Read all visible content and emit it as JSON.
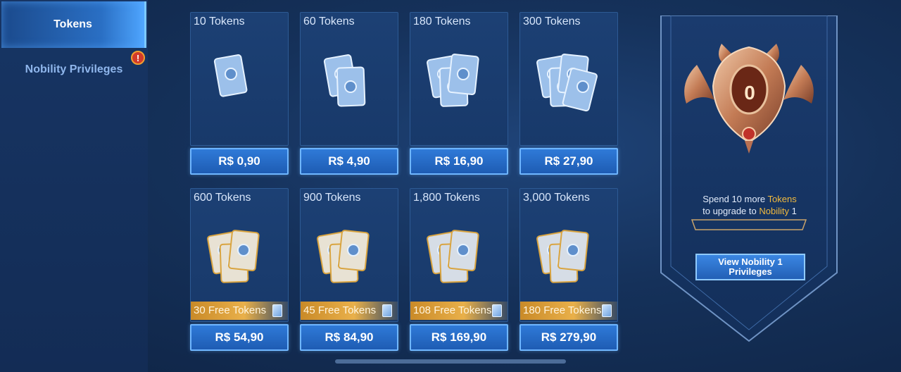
{
  "sidebar": {
    "tabs": [
      {
        "label": "Tokens",
        "active": true
      },
      {
        "label": "Nobility Privileges",
        "alert": "!"
      }
    ]
  },
  "packs": [
    {
      "name": "10 Tokens",
      "price": "R$ 0,90",
      "free": ""
    },
    {
      "name": "60 Tokens",
      "price": "R$ 4,90",
      "free": ""
    },
    {
      "name": "180 Tokens",
      "price": "R$ 16,90",
      "free": ""
    },
    {
      "name": "300 Tokens",
      "price": "R$ 27,90",
      "free": ""
    },
    {
      "name": "600 Tokens",
      "price": "R$ 54,90",
      "free": "30 Free Tokens"
    },
    {
      "name": "900 Tokens",
      "price": "R$ 84,90",
      "free": "45 Free Tokens"
    },
    {
      "name": "1,800 Tokens",
      "price": "R$ 169,90",
      "free": "108 Free Tokens"
    },
    {
      "name": "3,000 Tokens",
      "price": "R$ 279,90",
      "free": "180 Free Tokens"
    }
  ],
  "nobility": {
    "level": "0",
    "spend_prefix": "Spend 10 more",
    "spend_currency": "Tokens",
    "upgrade_prefix": "to upgrade to",
    "upgrade_target": "Nobility",
    "upgrade_level": "1",
    "view_button": "View Nobility 1 Privileges"
  },
  "colors": {
    "accent_gold": "#f0b93e",
    "button_blue": "#2f7ad8",
    "badge_red": "#d23a2a"
  }
}
